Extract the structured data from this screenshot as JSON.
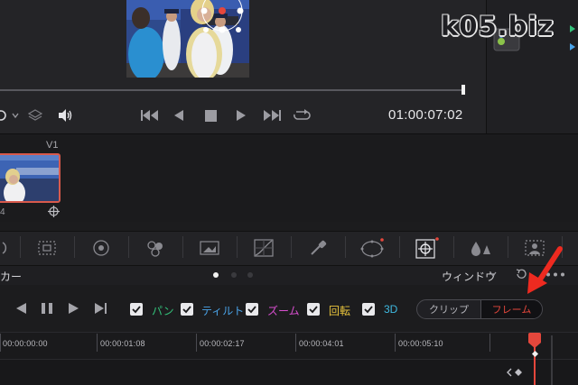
{
  "viewer": {
    "timecode": "01:00:07:02",
    "watermark": "k05.biz"
  },
  "clips": {
    "track_label": "V1",
    "clip_number": "4"
  },
  "tools": [
    {
      "name": "rgb-mixer-icon"
    },
    {
      "name": "motion-effects-icon"
    },
    {
      "name": "curves-icon"
    },
    {
      "name": "tracker-window-icon"
    },
    {
      "name": "color-warper-icon"
    },
    {
      "name": "qualifier-icon"
    },
    {
      "name": "power-window-icon"
    },
    {
      "name": "tracker-icon"
    },
    {
      "name": "blur-icon"
    },
    {
      "name": "key-icon"
    }
  ],
  "tracker": {
    "title": "カー",
    "window_menu": "ウィンドウ",
    "checks": [
      {
        "label": "パン",
        "color": "#33c27a"
      },
      {
        "label": "ティルト",
        "color": "#4aa3e8"
      },
      {
        "label": "ズーム",
        "color": "#d94fd0"
      },
      {
        "label": "回転",
        "color": "#e8c33c"
      },
      {
        "label": "3D",
        "color": "#3fb9e0"
      }
    ],
    "mode_clip": "クリップ",
    "mode_frame": "フレーム"
  },
  "ruler": {
    "labels": [
      "00:00:00:00",
      "00:00:01:08",
      "00:00:02:17",
      "00:00:04:01",
      "00:00:05:10"
    ]
  },
  "colors": {
    "accent_red": "#e5473c",
    "clip_border": "#d85a4c"
  }
}
